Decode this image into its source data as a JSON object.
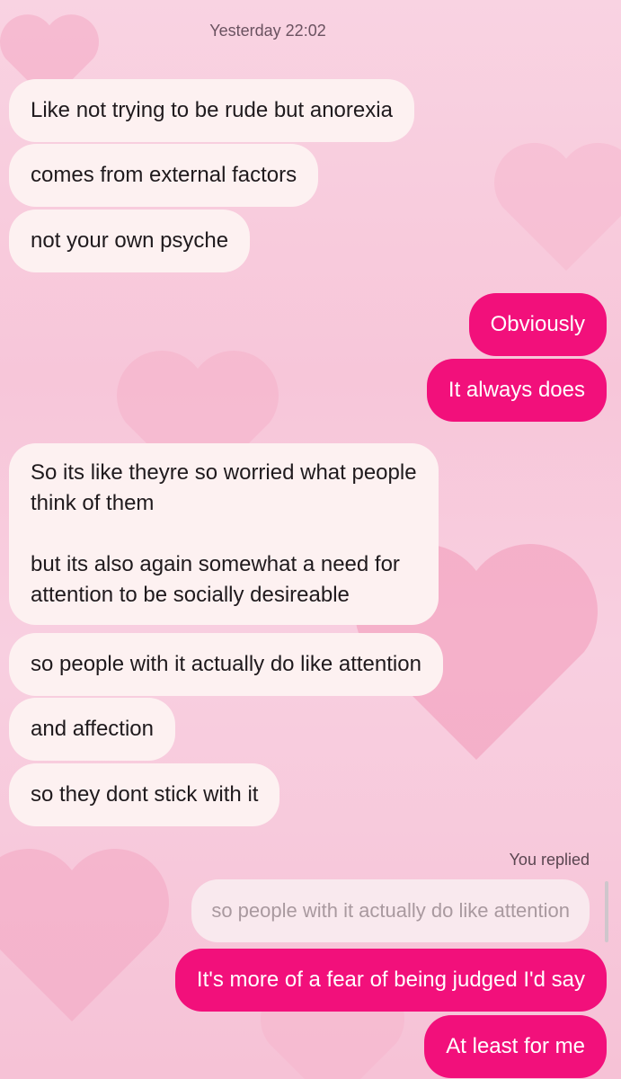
{
  "conversation": {
    "timestamp": "Yesterday 22:02",
    "incoming_group_1": [
      "Like not trying to be rude but anorexia",
      "comes from external factors",
      "not your own psyche"
    ],
    "outgoing_group_1": [
      "Obviously",
      "It always does"
    ],
    "incoming_group_2": [
      "So its like theyre so worried what people\nthink of them\n\nbut its also again somewhat a need for\nattention to be socially desireable",
      "so people with it actually do like attention",
      "and affection",
      "so they dont stick with it"
    ],
    "reply": {
      "label": "You replied",
      "quoted": "so people with it actually do like attention"
    },
    "outgoing_group_2": [
      "It's more of a fear of being judged I'd say",
      "At least for me"
    ]
  },
  "colors": {
    "outgoing_bubble": "#f2107b",
    "incoming_bubble": "#fdf1f1",
    "background": "#f8cfe0"
  }
}
